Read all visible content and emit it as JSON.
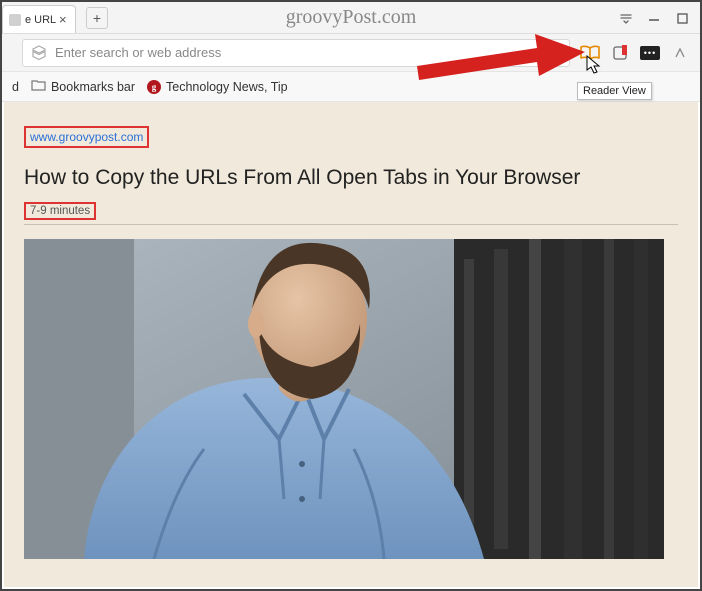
{
  "window": {
    "watermark": "groovyPost.com"
  },
  "tab": {
    "title": "e URLs Fro"
  },
  "address": {
    "placeholder": "Enter search or web address"
  },
  "bookmarks": {
    "cut_label": "d",
    "bar_label": "Bookmarks bar",
    "tech_label": "Technology News, Tip"
  },
  "article": {
    "domain": "www.groovypost.com",
    "title": "How to Copy the URLs From All Open Tabs in Your Browser",
    "read_time": "7-9 minutes"
  },
  "tooltip": "Reader View",
  "icons": {
    "gp_letter": "g",
    "dots": "•••"
  }
}
